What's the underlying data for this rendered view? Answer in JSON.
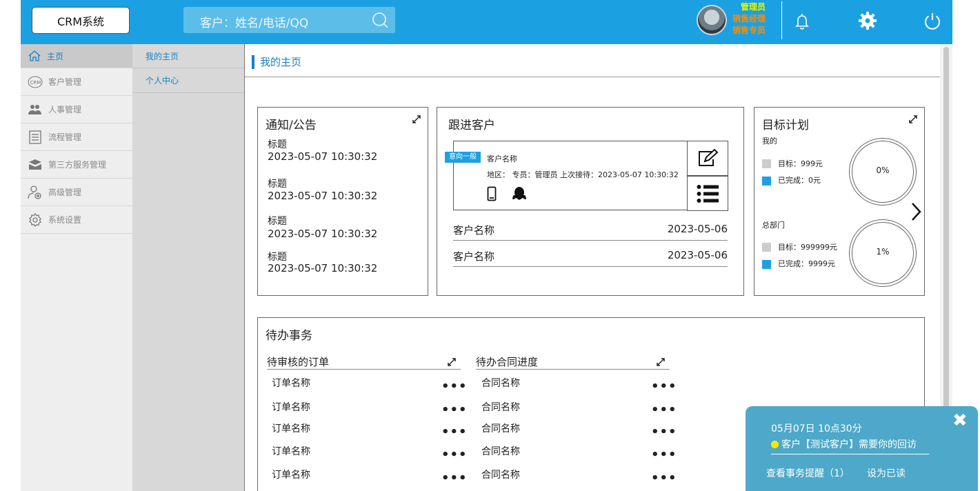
{
  "header": {
    "logo": "CRM系统",
    "search_placeholder": "客户：姓名/电话/QQ",
    "roles": [
      "管理员",
      "销售经理",
      "销售专员"
    ],
    "role_colors": [
      "#e8f400",
      "#ff8a00",
      "#ff8a00"
    ],
    "icons": [
      "bell-icon",
      "gear-icon",
      "power-icon"
    ]
  },
  "sidebar": {
    "items": [
      {
        "label": "主页",
        "icon": "home-icon"
      },
      {
        "label": "客户管理",
        "icon": "crm-icon"
      },
      {
        "label": "人事管理",
        "icon": "users-icon"
      },
      {
        "label": "流程管理",
        "icon": "process-icon"
      },
      {
        "label": "第三方服务管理",
        "icon": "service-icon"
      },
      {
        "label": "高级管理",
        "icon": "admin-icon"
      },
      {
        "label": "系统设置",
        "icon": "settings-icon"
      }
    ]
  },
  "subnav": {
    "items": [
      "我的主页",
      "个人中心"
    ]
  },
  "main": {
    "tab": "我的主页"
  },
  "notice": {
    "title": "通知/公告",
    "items": [
      {
        "title": "标题",
        "date": "2023-05-07 10:30:32"
      },
      {
        "title": "标题",
        "date": "2023-05-07 10:30:32"
      },
      {
        "title": "标题",
        "date": "2023-05-07 10:30:32"
      },
      {
        "title": "标题",
        "date": "2023-05-07 10:30:32"
      }
    ]
  },
  "followup": {
    "title": "跟进客户",
    "card": {
      "badge": "意向一般",
      "name": "客户名称",
      "info": "地区：  专员：管理员   上次接待：2023-05-07 10:30:32"
    },
    "rows": [
      {
        "name": "客户名称",
        "date": "2023-05-06"
      },
      {
        "name": "客户名称",
        "date": "2023-05-06"
      }
    ]
  },
  "goals": {
    "title": "目标计划",
    "mine": {
      "label": "我的",
      "target": "目标：999元",
      "done": "已完成：0元",
      "percent": "0%"
    },
    "dept": {
      "label": "总部门",
      "target": "目标：999999元",
      "done": "已完成：9999元",
      "percent": "1%"
    },
    "colors": {
      "target": "#cccccc",
      "done": "#1ba1e2"
    }
  },
  "todo": {
    "title": "待办事务",
    "orders": {
      "header": "待审核的订单",
      "items": [
        "订单名称",
        "订单名称",
        "订单名称",
        "订单名称",
        "订单名称"
      ]
    },
    "contracts": {
      "header": "待办合同进度",
      "items": [
        "合同名称",
        "合同名称",
        "合同名称",
        "合同名称",
        "合同名称"
      ]
    },
    "more": "•••"
  },
  "popup": {
    "time": "05月07日 10点30分",
    "message": "客户【测试客户】需要你的回访",
    "view_link": "查看事务提醒（1）",
    "mark_read": "设为已读",
    "close": "✖"
  }
}
